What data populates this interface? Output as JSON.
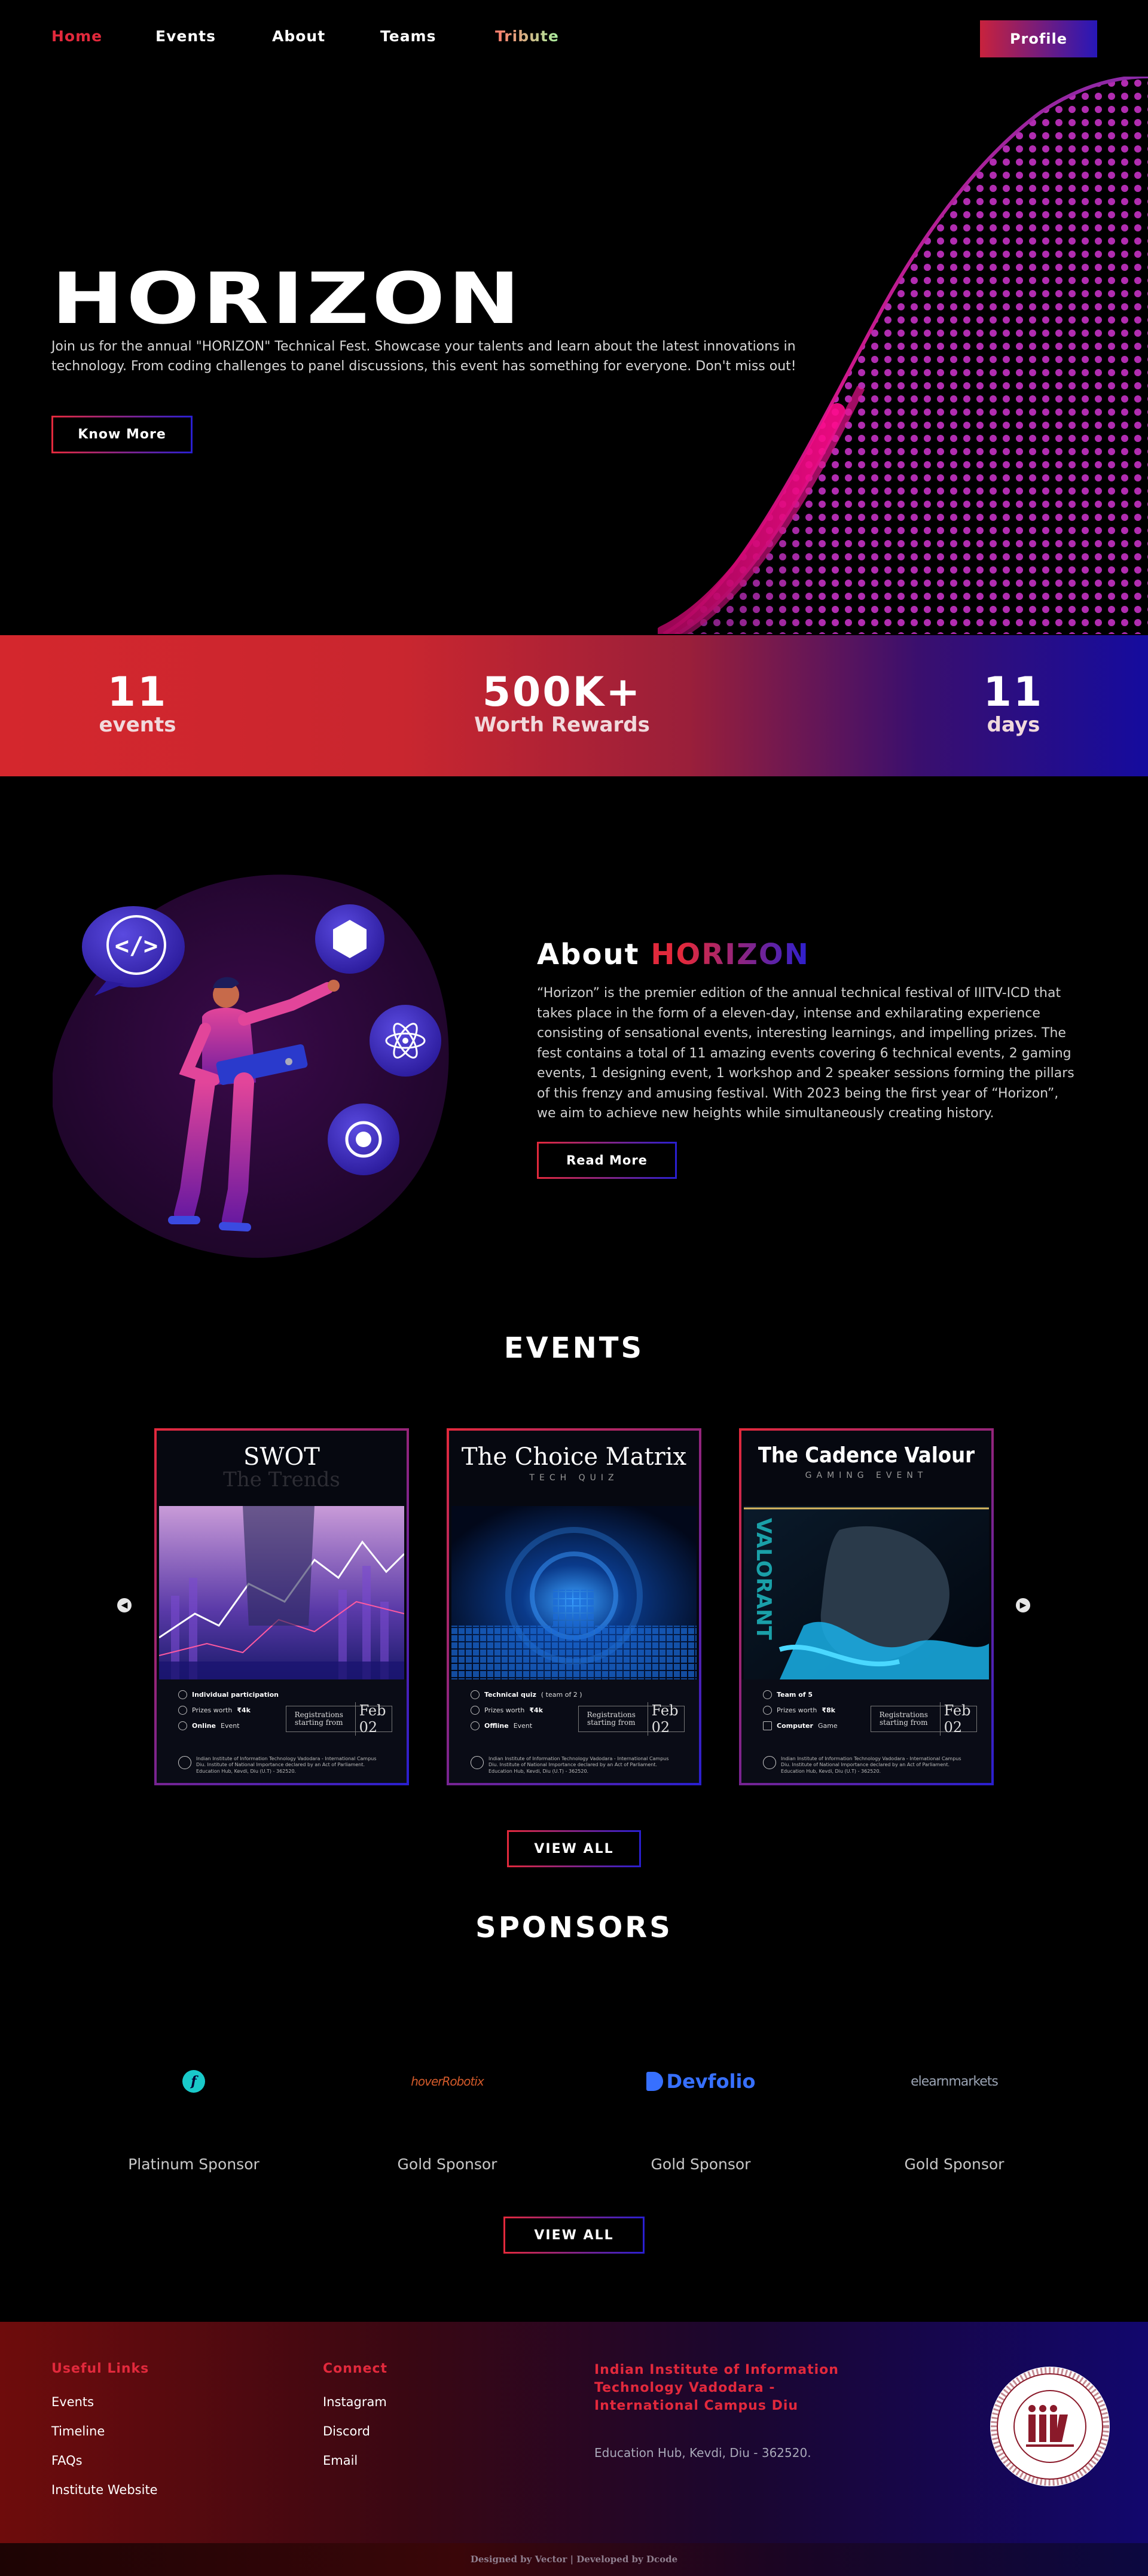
{
  "nav": {
    "items": [
      "Home",
      "Events",
      "About",
      "Teams",
      "Tribute"
    ],
    "profile_label": "Profile"
  },
  "hero": {
    "title": "HORIZON",
    "description": "Join us for the annual \"HORIZON\" Technical Fest. Showcase your talents and learn about the latest innovations in technology. From coding challenges to panel discussions, this event has something for everyone. Don't miss out!",
    "button_label": "Know More"
  },
  "stats": [
    {
      "value": "11",
      "label": "events"
    },
    {
      "value": "500K+",
      "label": "Worth Rewards"
    },
    {
      "value": "11",
      "label": "days"
    }
  ],
  "about": {
    "title_prefix": "About",
    "title_highlight": "HORIZON",
    "description": "“Horizon” is the premier edition of the annual technical festival of IIITV-ICD that takes place in the form of a eleven-day, intense and exhilarating experience consisting of sensational events, interesting learnings, and impelling prizes. The fest contains a total of 11 amazing events covering 6 technical events, 2 gaming events, 1 designing event, 1 workshop and 2 speaker sessions forming the pillars of this frenzy and amusing festival. With 2023 being the first year of “Horizon”, we aim to achieve new heights while simultaneously creating history.",
    "button_label": "Read More"
  },
  "events": {
    "title": "EVENTS",
    "view_all_label": "VIEW ALL",
    "cards": [
      {
        "title": "SWOT",
        "subtitle": "The Trends",
        "participation": "Individual participation",
        "prize_prefix": "Prizes worth",
        "prize_value": "₹4k",
        "mode": "Online",
        "mode_suffix": "Event",
        "reg_label": "Registrations starting from",
        "reg_date": "Feb 02",
        "footer": "Indian Institute of Information Technology Vadodara - International Campus Diu. Institute of National Importance declared by an Act of Parliament. Education Hub, Kevdi, Diu (U.T) - 362520."
      },
      {
        "title": "The Choice Matrix",
        "subtitle": "TECH QUIZ",
        "participation": "Technical quiz",
        "participation_suffix": "( team of 2 )",
        "prize_prefix": "Prizes worth",
        "prize_value": "₹4k",
        "mode": "Offline",
        "mode_suffix": "Event",
        "reg_label": "Registrations starting from",
        "reg_date": "Feb 02",
        "footer": "Indian Institute of Information Technology Vadodara - International Campus Diu. Institute of National Importance declared by an Act of Parliament. Education Hub, Kevdi, Diu (U.T) - 362520."
      },
      {
        "title": "The Cadence Valour",
        "subtitle": "GAMING EVENT",
        "side_text": "VALORANT",
        "participation": "Team of 5",
        "prize_prefix": "Prizes worth",
        "prize_value": "₹8k",
        "mode": "Computer",
        "mode_suffix": "Game",
        "reg_label": "Registrations starting from",
        "reg_date": "Feb 02",
        "footer": "Indian Institute of Information Technology Vadodara - International Campus Diu. Institute of National Importance declared by an Act of Parliament. Education Hub, Kevdi, Diu (U.T) - 362520."
      }
    ]
  },
  "sponsors": {
    "title": "SPONSORS",
    "view_all_label": "VIEW ALL",
    "items": [
      {
        "logo_text": "f",
        "tier": "Platinum Sponsor"
      },
      {
        "logo_text": "hoverRobotix",
        "tier": "Gold Sponsor"
      },
      {
        "logo_text": "Devfolio",
        "tier": "Gold Sponsor"
      },
      {
        "logo_text": "elearnmarkets",
        "tier": "Gold Sponsor"
      }
    ]
  },
  "footer": {
    "useful_links_title": "Useful Links",
    "useful_links": [
      "Events",
      "Timeline",
      "FAQs",
      "Institute Website"
    ],
    "connect_title": "Connect",
    "connect_links": [
      "Instagram",
      "Discord",
      "Email"
    ],
    "institute_name": "Indian Institute of Information Technology Vadodara - International Campus Diu",
    "institute_address": "Education Hub, Kevdi, Diu - 362520.",
    "credits": "Designed by Vector | Developed by Dcode"
  },
  "colors": {
    "accent_red": "#e2293c",
    "accent_blue": "#2a1fd0",
    "background": "#000000"
  }
}
